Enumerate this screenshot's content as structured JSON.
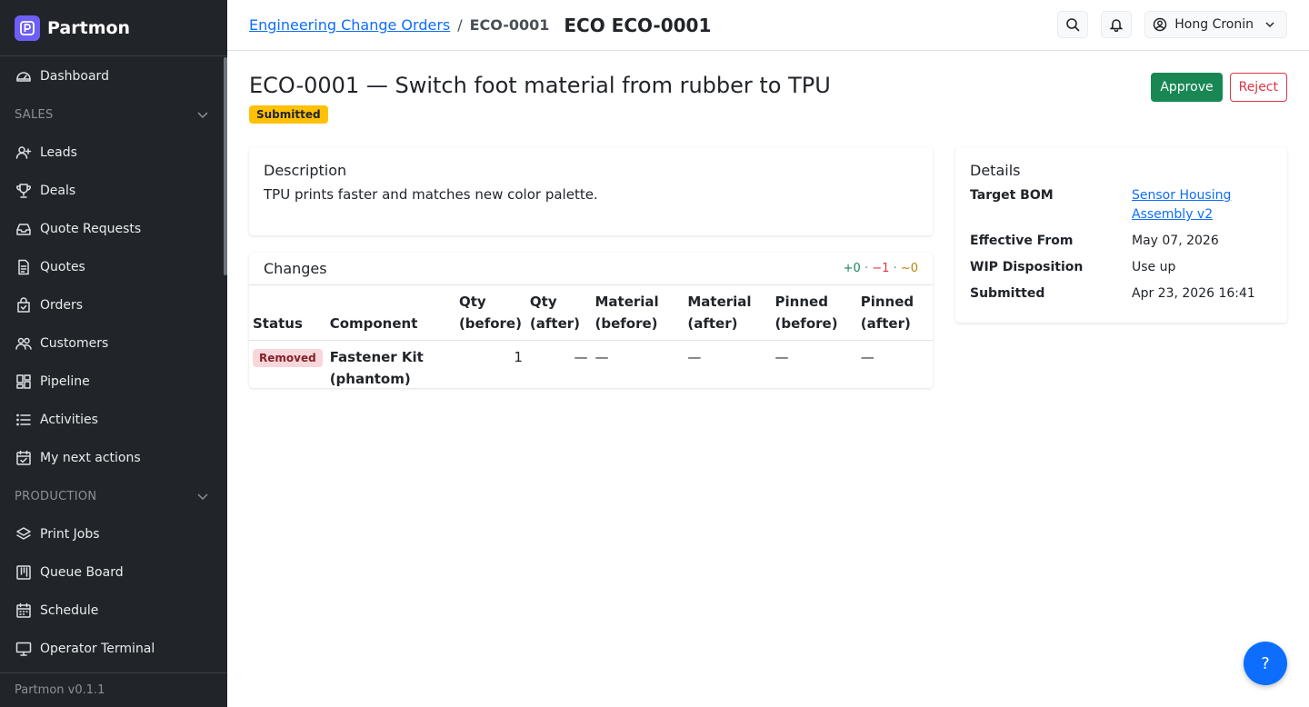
{
  "app": {
    "name": "Partmon",
    "version": "Partmon v0.1.1"
  },
  "sidebar": {
    "items_top": [
      {
        "label": "Dashboard",
        "icon": "dashboard-icon"
      }
    ],
    "sections": [
      {
        "label": "SALES",
        "items": [
          {
            "label": "Leads",
            "icon": "person-add-icon"
          },
          {
            "label": "Deals",
            "icon": "trophy-icon"
          },
          {
            "label": "Quote Requests",
            "icon": "inbox-icon"
          },
          {
            "label": "Quotes",
            "icon": "document-icon"
          },
          {
            "label": "Orders",
            "icon": "bag-icon"
          },
          {
            "label": "Customers",
            "icon": "people-icon"
          },
          {
            "label": "Pipeline",
            "icon": "kanban-icon"
          },
          {
            "label": "Activities",
            "icon": "list-icon"
          },
          {
            "label": "My next actions",
            "icon": "calendar-check-icon"
          }
        ]
      },
      {
        "label": "PRODUCTION",
        "items": [
          {
            "label": "Print Jobs",
            "icon": "layers-icon"
          },
          {
            "label": "Queue Board",
            "icon": "board-icon"
          },
          {
            "label": "Schedule",
            "icon": "calendar-icon"
          },
          {
            "label": "Operator Terminal",
            "icon": "monitor-icon"
          }
        ]
      }
    ]
  },
  "header": {
    "breadcrumb_link": "Engineering Change Orders",
    "breadcrumb_sep": "/",
    "breadcrumb_current": "ECO-0001",
    "title": "ECO ECO-0001",
    "user_name": "Hong Cronin"
  },
  "page": {
    "title": "ECO-0001 — Switch foot material from rubber to TPU",
    "status": "Submitted",
    "approve_label": "Approve",
    "reject_label": "Reject"
  },
  "description": {
    "heading": "Description",
    "text": "TPU prints faster and matches new color palette."
  },
  "changes": {
    "heading": "Changes",
    "summary": {
      "added": "+0",
      "removed": "−1",
      "modified": "~0",
      "sep": "·"
    },
    "columns": {
      "status": "Status",
      "component": "Component",
      "qty_before_1": "Qty",
      "qty_before_2": "(before)",
      "qty_after_1": "Qty",
      "qty_after_2": "(after)",
      "mat_before_1": "Material",
      "mat_before_2": "(before)",
      "mat_after_1": "Material",
      "mat_after_2": "(after)",
      "pin_before_1": "Pinned",
      "pin_before_2": "(before)",
      "pin_after_1": "Pinned",
      "pin_after_2": "(after)"
    },
    "rows": [
      {
        "status": "Removed",
        "component_1": "Fastener Kit",
        "component_2": "(phantom)",
        "qty_before": "1",
        "qty_after": "—",
        "material_before": "—",
        "material_after": "—",
        "pinned_before": "—",
        "pinned_after": "—"
      }
    ]
  },
  "details": {
    "heading": "Details",
    "target_bom_label": "Target BOM",
    "target_bom_value_1": "Sensor Housing",
    "target_bom_value_2": "Assembly v2",
    "effective_from_label": "Effective From",
    "effective_from_value": "May 07, 2026",
    "wip_label": "WIP Disposition",
    "wip_value": "Use up",
    "submitted_label": "Submitted",
    "submitted_value": "Apr 23, 2026 16:41"
  },
  "help": {
    "label": "?"
  },
  "colors": {
    "sidebar_bg": "#212529",
    "brand_logo": "#6d5ef5",
    "link": "#0d6efd",
    "approve": "#198754",
    "reject": "#dc3545",
    "status_submitted": "#ffc107",
    "status_removed_bg": "#f8d7da"
  }
}
